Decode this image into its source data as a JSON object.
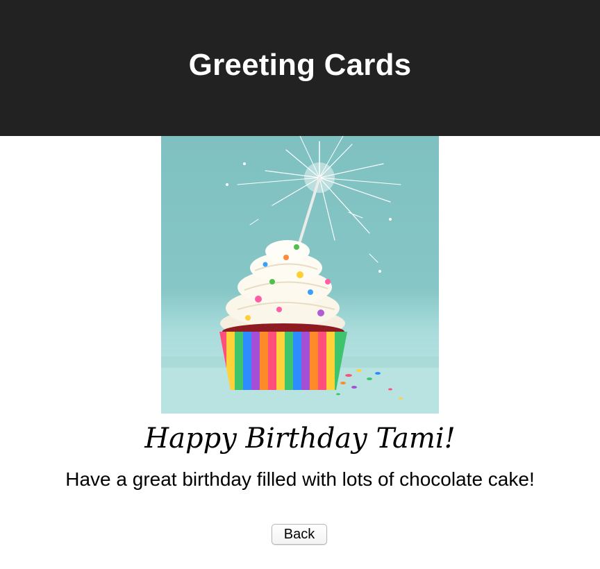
{
  "header": {
    "title": "Greeting Cards"
  },
  "card": {
    "image": {
      "icon": "cupcake-with-sparkler-image",
      "colors": {
        "background": "#84c4c4",
        "frosting": "#fbf6ea",
        "cake": "#8e1b22",
        "spark": "#ffffff"
      }
    },
    "title": "Happy Birthday Tami!",
    "message": "Have a great birthday filled with lots of chocolate cake!",
    "back_label": "Back"
  },
  "colors": {
    "header_bg": "#222222",
    "header_text": "#ffffff",
    "page_bg": "#ffffff"
  }
}
